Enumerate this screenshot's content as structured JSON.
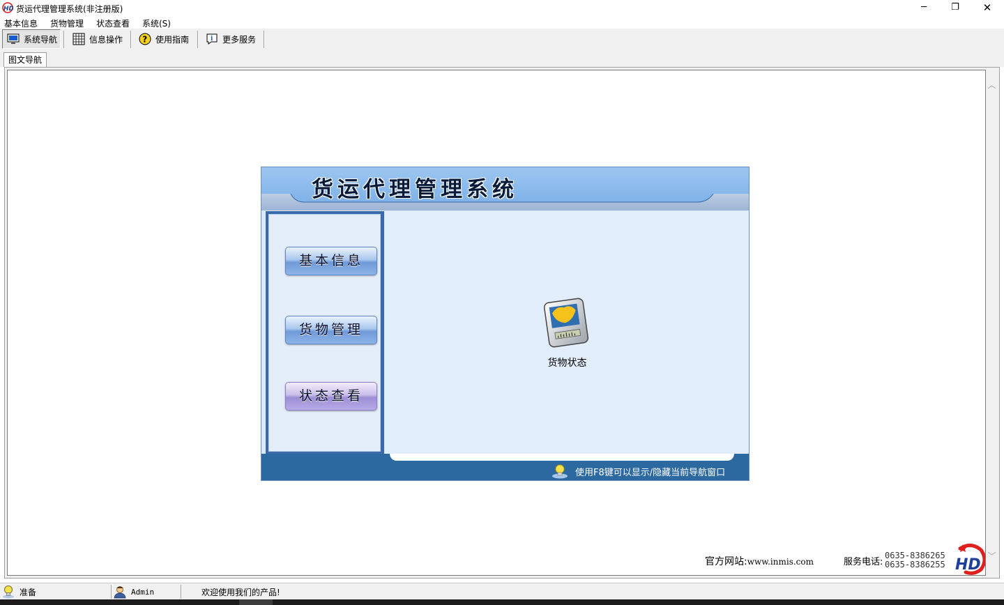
{
  "window": {
    "title": "货运代理管理系统(非注册版)",
    "minimize": "─",
    "maximize": "❐",
    "close": "✕"
  },
  "menu": {
    "items": [
      {
        "label": "基本信息"
      },
      {
        "label": "货物管理"
      },
      {
        "label": "状态查看"
      },
      {
        "label": "系统(S)"
      }
    ]
  },
  "toolbar": {
    "items": [
      {
        "label": "系统导航",
        "icon": "monitor-icon",
        "active": true
      },
      {
        "label": "信息操作",
        "icon": "grid-icon",
        "active": false
      },
      {
        "label": "使用指南",
        "icon": "help-icon",
        "active": false
      },
      {
        "label": "更多服务",
        "icon": "info-icon",
        "active": false
      }
    ]
  },
  "tabs": [
    {
      "label": "图文导航",
      "selected": true
    }
  ],
  "nav": {
    "title": "货运代理管理系统",
    "buttons": [
      {
        "label": "基本信息",
        "active": false
      },
      {
        "label": "货物管理",
        "active": false
      },
      {
        "label": "状态查看",
        "active": true
      }
    ],
    "function": {
      "label": "货物状态",
      "icon": "cargo-status-icon"
    },
    "tip": "使用F8键可以显示/隐藏当前导航窗口"
  },
  "contact": {
    "site_label": "官方网站:",
    "site_url": "www.inmis.com",
    "phone_label": "服务电话:",
    "phones": [
      "0635-8386265",
      "0635-8386255"
    ]
  },
  "status": {
    "state": "准备",
    "user": "Admin",
    "message": "欢迎使用我们的产品!"
  },
  "colors": {
    "nav_blue": "#2c69a0",
    "header_blue": "#8fbcec",
    "panel_bg": "#e2edfb"
  }
}
